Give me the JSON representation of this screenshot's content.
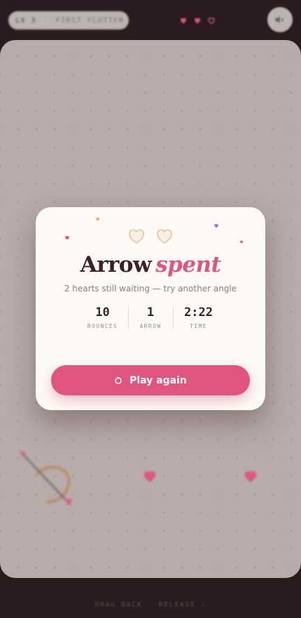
{
  "header": {
    "level": "LV 3",
    "separator": "·",
    "level_name": "FIRST FLUTTER",
    "lives": [
      {
        "state": "full",
        "color": "#e0557f"
      },
      {
        "state": "full",
        "color": "#e0557f"
      },
      {
        "state": "empty",
        "color": "#d27a93"
      }
    ],
    "sound_icon": "speaker-icon"
  },
  "result": {
    "hearts": [
      {
        "state": "empty",
        "icon": "heart-outline-icon"
      },
      {
        "state": "empty",
        "icon": "heart-outline-icon"
      }
    ],
    "title_main": "Arrow",
    "title_accent": "spent",
    "subtitle": "2 hearts still waiting — try another angle",
    "stats": [
      {
        "value": "10",
        "label": "BOUNCES"
      },
      {
        "value": "1",
        "label": "ARROW"
      },
      {
        "value": "2:22",
        "label": "TIME"
      }
    ],
    "play_again_label": "Play again",
    "play_again_icon": "restart-icon"
  },
  "footer": {
    "left": "DRAG BACK",
    "right": "RELEASE ⇩"
  },
  "colors": {
    "accent": "#e0557f",
    "title": "#3b2226",
    "background": "#2a1c1e"
  }
}
